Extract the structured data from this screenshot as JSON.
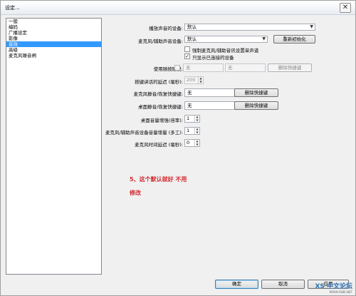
{
  "window": {
    "title": "设定..."
  },
  "title_controls": {
    "close": "✕"
  },
  "sidebar": {
    "items": [
      {
        "label": "一般",
        "selected": false
      },
      {
        "label": "编码",
        "selected": false
      },
      {
        "label": "广播设定",
        "selected": false
      },
      {
        "label": "影像",
        "selected": false
      },
      {
        "label": "音效",
        "selected": true
      },
      {
        "label": "高级",
        "selected": false
      },
      {
        "label": "麦克风噪音闸",
        "selected": false
      }
    ]
  },
  "audio": {
    "playback_device_label": "播放声音的设备:",
    "playback_device_value": "默认",
    "mic_device_label": "麦克风/辅助声音设备:",
    "mic_device_value": "默认",
    "refresh_button": "重新初始化",
    "force_mono_label": "强制麦克风/辅助音讯设置单声道",
    "force_mono_checked": false,
    "connected_only_label": "只显示已连接的设备",
    "connected_only_checked": true,
    "push_to_talk_label": "使用随按随说:",
    "push_to_talk_checked": false,
    "push_to_talk_hotkey1": "无",
    "push_to_talk_hotkey2": "无",
    "clear_hotkey_ptt": "删除快捷键",
    "ptt_delay_label": "按键讲话的延迟 (毫秒):",
    "ptt_delay_value": "200",
    "mic_mute_hotkey_label": "麦克风静音/恢复快捷键:",
    "mic_mute_hotkey_value": "无",
    "clear_hotkey_mic": "删除快捷键",
    "desktop_mute_hotkey_label": "桌面静音/恢复快捷键:",
    "desktop_mute_hotkey_value": "无",
    "clear_hotkey_desktop": "删除快捷键",
    "desktop_boost_label": "桌面音量增强(倍率):",
    "desktop_boost_value": "1",
    "mic_boost_label": "麦克风/辅助声音设备音量增量 (多工):",
    "mic_boost_value": "1",
    "mic_delay_label": "麦克风时间延迟 (毫秒):",
    "mic_delay_value": "0"
  },
  "annotation": {
    "line1": "5、这个默认就好 不用",
    "line2": "修改"
  },
  "footer": {
    "ok": "确定",
    "cancel": "取消",
    "apply": "应用"
  },
  "watermark": {
    "main": "XS 中文论坛",
    "sub": "WWW.XSBE.NET"
  },
  "colors": {
    "selection": "#3399ff",
    "annotation": "#d2262b"
  }
}
